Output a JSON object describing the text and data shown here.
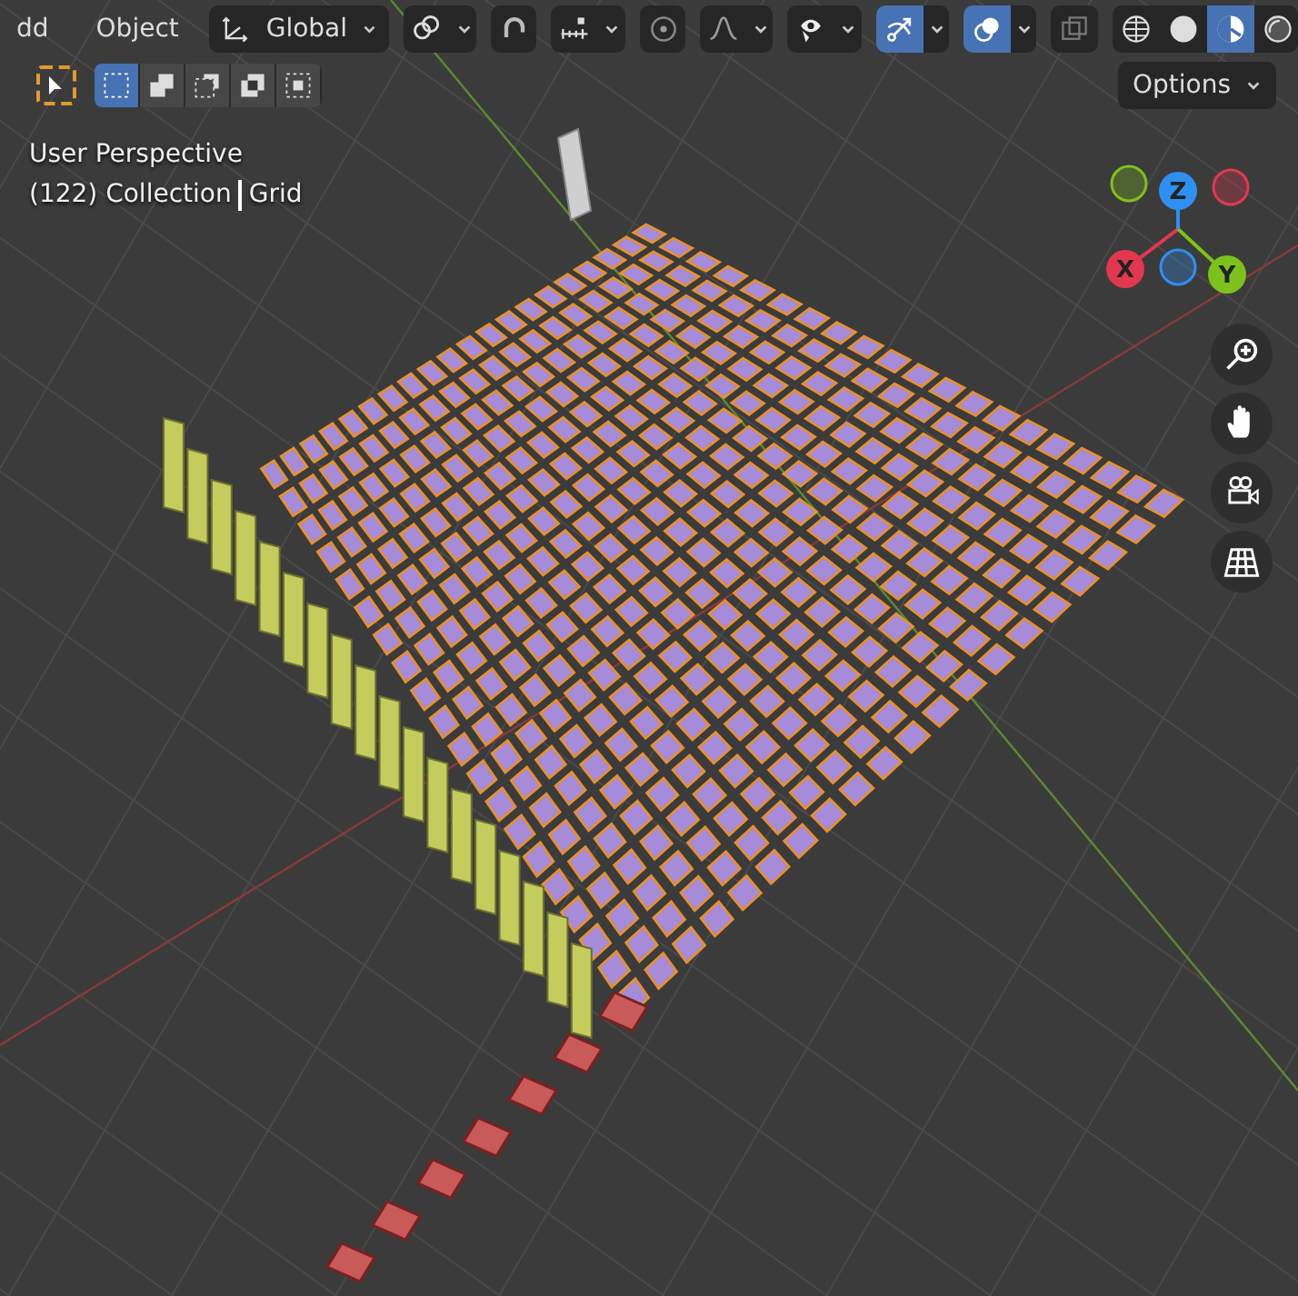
{
  "header": {
    "menus": [
      {
        "label": "dd"
      },
      {
        "label": "Object"
      }
    ],
    "orientation": {
      "label": "Global"
    },
    "tools": [
      {
        "on": false
      },
      {
        "on": false
      },
      {
        "on": false
      },
      {
        "on": false
      },
      {
        "on": false
      },
      {
        "on": false
      },
      {
        "on": true
      },
      {
        "on": true
      },
      {
        "on": false
      }
    ],
    "shading": [
      {
        "selected": false
      },
      {
        "selected": false
      },
      {
        "selected": true
      },
      {
        "selected": false
      }
    ]
  },
  "toolbar": {
    "select_modes": [
      {
        "selected": true
      },
      {
        "selected": false
      },
      {
        "selected": false
      },
      {
        "selected": false
      },
      {
        "selected": false
      }
    ],
    "options": {
      "label": "Options"
    }
  },
  "viewport": {
    "view_name": "User Perspective",
    "frame": "(122) Collection",
    "object": "Grid"
  },
  "gizmo": {
    "axes": [
      {
        "label": "X",
        "color": "#e0394f"
      },
      {
        "label": "Y",
        "color": "#7dc11d"
      },
      {
        "label": "Z",
        "color": "#2f8ff2"
      }
    ]
  }
}
